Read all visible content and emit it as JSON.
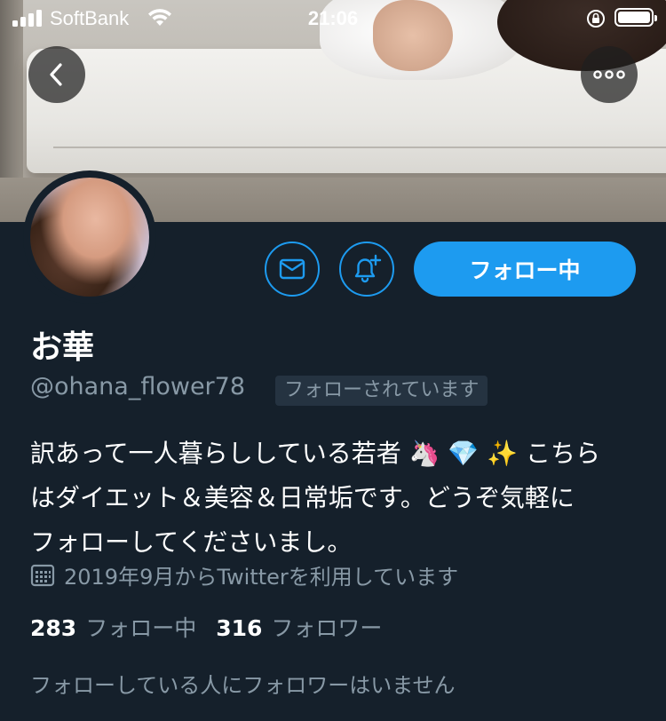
{
  "status_bar": {
    "carrier": "SoftBank",
    "time": "21:06"
  },
  "profile": {
    "name": "お華",
    "handle": "@ohana_flower78",
    "follows_you_badge": "フォローされています",
    "bio": "訳あって一人暮らししている若者 🦄 💎 ✨ こちら\nはダイエット＆美容＆日常垢です。どうぞ気軽に\nフォローしてくださいまし。",
    "joined": "2019年9月からTwitterを利用しています",
    "following_count": "283",
    "following_label": "フォロー中",
    "followers_count": "316",
    "followers_label": "フォロワー",
    "known_followers": "フォローしている人にフォロワーはいません"
  },
  "actions": {
    "follow_button_label": "フォロー中"
  },
  "icons": [
    "back-icon",
    "more-icon",
    "mail-icon",
    "bell-plus-icon",
    "calendar-icon",
    "wifi-icon",
    "signal-icon",
    "rotation-lock-icon",
    "battery-icon"
  ],
  "colors": {
    "accent": "#1d9bf0",
    "background": "#15202b",
    "secondary_text": "#8899a6",
    "badge_bg": "#253341"
  }
}
